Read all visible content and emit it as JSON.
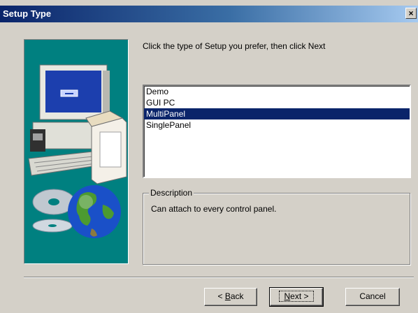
{
  "window": {
    "title": "Setup Type",
    "close_glyph": "×"
  },
  "instruction": "Click the type of Setup you prefer, then click Next",
  "setup_types": [
    {
      "label": "Demo",
      "selected": false
    },
    {
      "label": "GUI PC",
      "selected": false
    },
    {
      "label": "MultiPanel",
      "selected": true
    },
    {
      "label": "SinglePanel",
      "selected": false
    }
  ],
  "description": {
    "legend": "Description",
    "text": "Can attach to every control panel."
  },
  "buttons": {
    "back": {
      "prefix": "< ",
      "mnemonic": "B",
      "rest": "ack"
    },
    "next": {
      "mnemonic": "N",
      "rest": "ext >"
    },
    "cancel": "Cancel"
  },
  "colors": {
    "dialog_bg": "#d4d0c8",
    "art_bg": "#008080",
    "selection": "#0a246a",
    "title_start": "#0a246a",
    "title_end": "#a6caf0"
  }
}
